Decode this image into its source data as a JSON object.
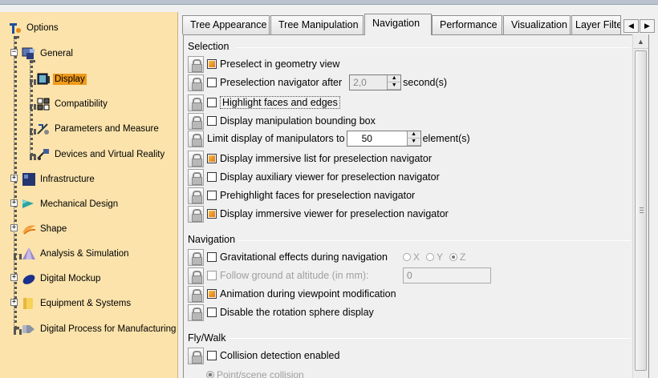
{
  "tree": {
    "root": {
      "label": "Options",
      "icon": "options-icon"
    },
    "items": [
      {
        "label": "General",
        "icon": "general-icon",
        "expander": "−"
      },
      {
        "label": "Display",
        "icon": "display-icon",
        "selected": true
      },
      {
        "label": "Compatibility",
        "icon": "compatibility-icon"
      },
      {
        "label": "Parameters and Measure",
        "icon": "parameters-icon"
      },
      {
        "label": "Devices and Virtual Reality",
        "icon": "devices-icon"
      },
      {
        "label": "Infrastructure",
        "icon": "infrastructure-icon",
        "expander": "+"
      },
      {
        "label": "Mechanical Design",
        "icon": "mechanical-design-icon",
        "expander": "+"
      },
      {
        "label": "Shape",
        "icon": "shape-icon",
        "expander": "+"
      },
      {
        "label": "Analysis & Simulation",
        "icon": "analysis-icon"
      },
      {
        "label": "Digital Mockup",
        "icon": "digital-mockup-icon",
        "expander": "+"
      },
      {
        "label": "Equipment & Systems",
        "icon": "equipment-icon",
        "expander": "+"
      },
      {
        "label": "Digital Process for Manufacturing",
        "icon": "digital-process-icon"
      }
    ]
  },
  "tabs": [
    {
      "label": "Tree Appearance"
    },
    {
      "label": "Tree Manipulation"
    },
    {
      "label": "Navigation",
      "active": true
    },
    {
      "label": "Performance"
    },
    {
      "label": "Visualization"
    },
    {
      "label": "Layer Filte"
    }
  ],
  "tab_scroll": {
    "left": "◀",
    "right": "▶"
  },
  "selection": {
    "title": "Selection",
    "preselect": {
      "label": "Preselect in geometry view",
      "checked": true
    },
    "preselection_navigator": {
      "label": "Preselection navigator after",
      "checked": false,
      "value": "2,0",
      "unit": "second(s)"
    },
    "highlight": {
      "label": "Highlight faces and edges",
      "checked": false
    },
    "bounding_box": {
      "label": "Display manipulation bounding box",
      "checked": false
    },
    "limit_manipulators": {
      "label": "Limit display of manipulators to",
      "value": "50",
      "unit": "element(s)"
    },
    "immersive_list": {
      "label": "Display immersive list for preselection navigator",
      "checked": true
    },
    "auxiliary_viewer": {
      "label": "Display auxiliary viewer for preselection navigator",
      "checked": false
    },
    "prehighlight": {
      "label": "Prehighlight faces for preselection navigator",
      "checked": false
    },
    "immersive_viewer": {
      "label": "Display immersive viewer for preselection navigator",
      "checked": true
    }
  },
  "navigation": {
    "title": "Navigation",
    "gravitational": {
      "label": "Gravitational effects during navigation",
      "checked": false
    },
    "axes": [
      {
        "label": "X",
        "on": false
      },
      {
        "label": "Y",
        "on": false
      },
      {
        "label": "Z",
        "on": true
      }
    ],
    "follow_ground": {
      "label": "Follow ground at altitude (in mm):",
      "value": "0"
    },
    "animation": {
      "label": "Animation during viewpoint modification",
      "checked": true
    },
    "rotation_sphere": {
      "label": "Disable the rotation sphere display",
      "checked": false
    }
  },
  "flywalk": {
    "title": "Fly/Walk",
    "collision": {
      "label": "Collision detection enabled",
      "checked": false
    },
    "point_scene": {
      "label": "Point/scene collision"
    }
  },
  "colors": {
    "tree_bg": "#fbe3ab",
    "selected": "#f09a1a",
    "checkbox_on": "#e27510"
  }
}
